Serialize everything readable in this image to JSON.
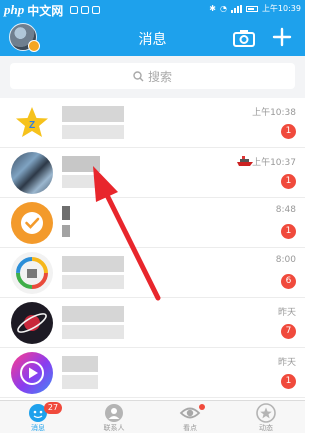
{
  "status_bar": {
    "watermark_logo": "php",
    "watermark_site": "中文网",
    "time": "上午10:39"
  },
  "header": {
    "title": "消息",
    "colors": {
      "accent": "#1ea1ec"
    }
  },
  "search": {
    "placeholder": "搜索"
  },
  "conversations": [
    {
      "avatar": "qzone-star-icon",
      "name": "",
      "preview": "",
      "time": "上午10:38",
      "unread": "1"
    },
    {
      "avatar": "photo-avatar",
      "name": "",
      "preview": "",
      "time": "上午10:37",
      "unread": "1"
    },
    {
      "avatar": "shield-check-icon",
      "name": "",
      "preview": "",
      "time": "8:48",
      "unread": "1"
    },
    {
      "avatar": "colorful-logo-icon",
      "name": "",
      "preview": "",
      "time": "8:00",
      "unread": "6"
    },
    {
      "avatar": "planet-icon",
      "name": "",
      "preview": "",
      "time": "昨天",
      "unread": "7"
    },
    {
      "avatar": "video-play-icon",
      "name": "",
      "preview": "",
      "time": "昨天",
      "unread": "1"
    }
  ],
  "tabbar": {
    "tabs": [
      {
        "label": "消息",
        "badge": "27",
        "active": true
      },
      {
        "label": "联系人"
      },
      {
        "label": "看点"
      },
      {
        "label": "动态"
      }
    ],
    "badge_color": "#f04a3c"
  }
}
